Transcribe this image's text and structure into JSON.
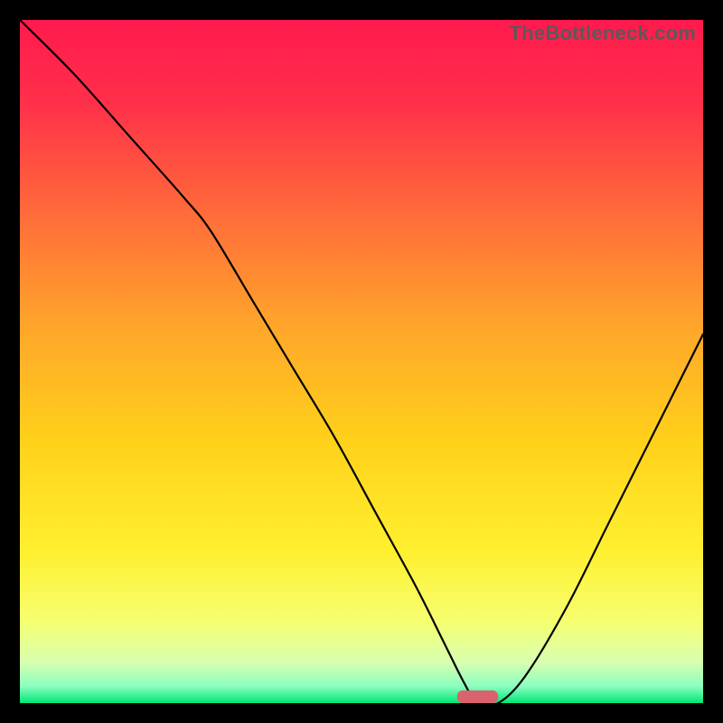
{
  "watermark": "TheBottleneck.com",
  "chart_data": {
    "type": "line",
    "title": "",
    "xlabel": "",
    "ylabel": "",
    "xlim": [
      0,
      100
    ],
    "ylim": [
      0,
      100
    ],
    "grid": false,
    "legend": false,
    "background_gradient": {
      "stops": [
        {
          "pos": 0.0,
          "color": "#ff1a4d"
        },
        {
          "pos": 0.12,
          "color": "#ff2f4a"
        },
        {
          "pos": 0.28,
          "color": "#ff6a3a"
        },
        {
          "pos": 0.45,
          "color": "#ffa62a"
        },
        {
          "pos": 0.62,
          "color": "#ffd21a"
        },
        {
          "pos": 0.78,
          "color": "#fff030"
        },
        {
          "pos": 0.88,
          "color": "#f6ff70"
        },
        {
          "pos": 0.94,
          "color": "#d8ffb0"
        },
        {
          "pos": 0.975,
          "color": "#8cffc0"
        },
        {
          "pos": 1.0,
          "color": "#00e676"
        }
      ]
    },
    "series": [
      {
        "name": "bottleneck-curve",
        "x": [
          0,
          8,
          16,
          24,
          28,
          34,
          40,
          46,
          52,
          58,
          62,
          65,
          67,
          70,
          74,
          80,
          86,
          92,
          100
        ],
        "y": [
          100,
          92,
          83,
          74,
          69,
          59,
          49,
          39,
          28,
          17,
          9,
          3,
          0,
          0,
          4,
          14,
          26,
          38,
          54
        ]
      }
    ],
    "marker": {
      "name": "optimal-zone",
      "x": 67,
      "y": 0,
      "width_pct": 6,
      "color": "#d9626f"
    }
  }
}
